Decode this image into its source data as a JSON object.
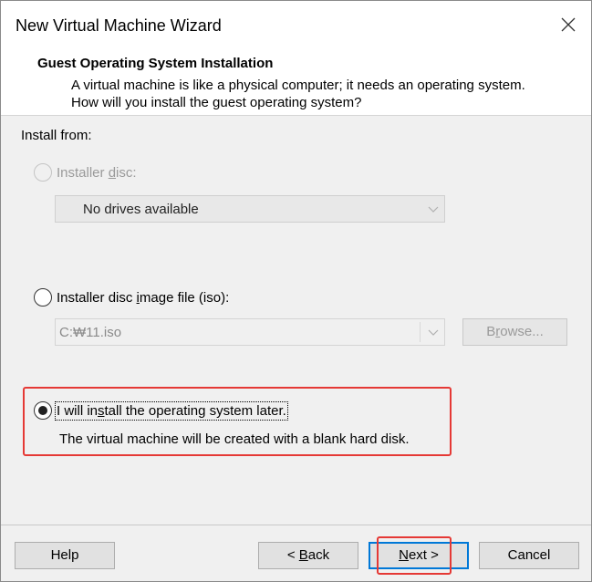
{
  "window": {
    "title": "New Virtual Machine Wizard"
  },
  "header": {
    "title": "Guest Operating System Installation",
    "description": "A virtual machine is like a physical computer; it needs an operating system. How will you install the guest operating system?"
  },
  "install_from_label": "Install from:",
  "options": {
    "disc": {
      "label_pre": "Installer ",
      "label_accel": "d",
      "label_post": "isc:",
      "enabled": false,
      "checked": false
    },
    "drive_select": {
      "value": "No drives available"
    },
    "iso": {
      "label_pre": "Installer disc ",
      "label_accel": "i",
      "label_post": "mage file (iso):",
      "enabled": true,
      "checked": false
    },
    "iso_path": {
      "value": "C:₩11.iso"
    },
    "browse": {
      "label_pre": "B",
      "label_accel": "r",
      "label_post": "owse..."
    },
    "later": {
      "label_pre": "I will in",
      "label_accel": "s",
      "label_post": "tall the operating system later.",
      "checked": true,
      "description": "The virtual machine will be created with a blank hard disk."
    }
  },
  "buttons": {
    "help": "Help",
    "back_pre": "< ",
    "back_accel": "B",
    "back_post": "ack",
    "next_accel": "N",
    "next_post": "ext >",
    "cancel": "Cancel"
  },
  "colors": {
    "highlight_box": "#e53935",
    "default_button_border": "#0078d7"
  },
  "icons": [
    "close-icon",
    "chevron-down-icon"
  ]
}
